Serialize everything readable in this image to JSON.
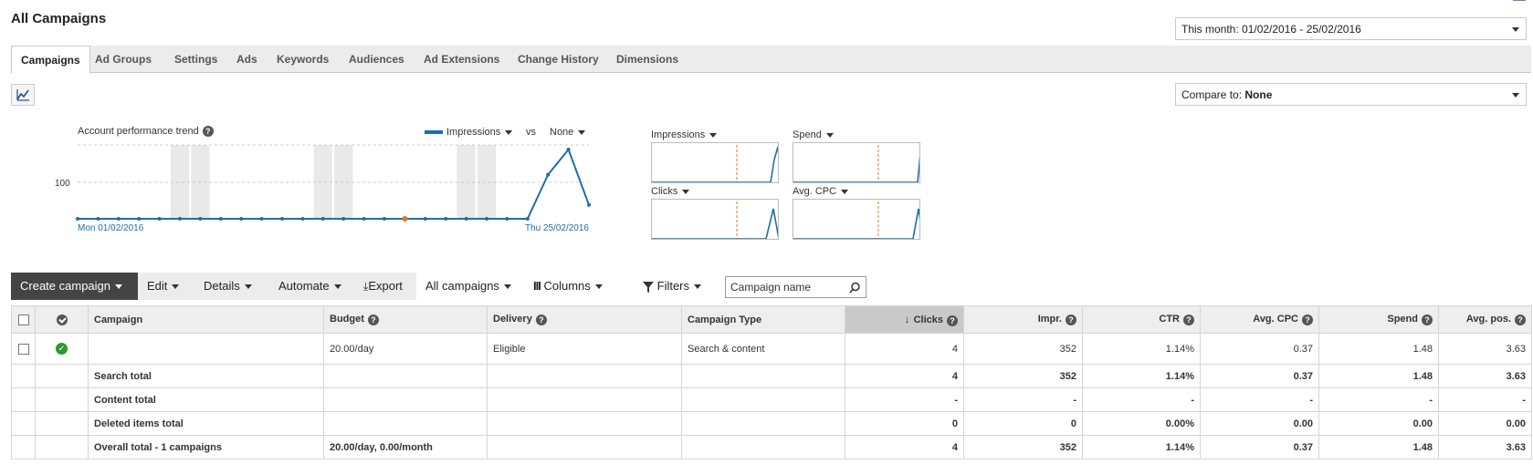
{
  "page": {
    "title": "All Campaigns"
  },
  "date_range": {
    "label": "This month: 01/02/2016 - 25/02/2016"
  },
  "compare": {
    "prefix": "Compare to: ",
    "value": "None"
  },
  "tabs": [
    {
      "label": "Campaigns",
      "active": true
    },
    {
      "label": "Ad Groups"
    },
    {
      "label": "Settings"
    },
    {
      "label": "Ads"
    },
    {
      "label": "Keywords"
    },
    {
      "label": "Audiences"
    },
    {
      "label": "Ad Extensions"
    },
    {
      "label": "Change History"
    },
    {
      "label": "Dimensions"
    }
  ],
  "trend": {
    "title": "Account performance trend",
    "metric": "Impressions",
    "vs": "vs",
    "compare_metric": "None",
    "y_tick": "100",
    "start_label": "Mon 01/02/2016",
    "end_label": "Thu 25/02/2016",
    "color": "#1f6ea8",
    "highlight_color": "#e8741a"
  },
  "chart_data": {
    "type": "line",
    "title": "Account performance trend",
    "series": [
      {
        "name": "Impressions",
        "values": [
          0,
          0,
          0,
          0,
          0,
          0,
          0,
          0,
          0,
          0,
          0,
          0,
          0,
          0,
          0,
          0,
          0,
          0,
          0,
          0,
          0,
          0,
          0,
          121,
          190,
          38
        ]
      }
    ],
    "x_start": "Mon 01/02/2016",
    "x_end": "Thu 25/02/2016",
    "weekend_days": [
      [
        5,
        6
      ],
      [
        12,
        13
      ],
      [
        19,
        20
      ]
    ],
    "highlight_day": 16,
    "yticks": [
      100
    ],
    "grid": true
  },
  "mini_charts": [
    {
      "label": "Impressions"
    },
    {
      "label": "Spend"
    },
    {
      "label": "Clicks"
    },
    {
      "label": "Avg. CPC"
    }
  ],
  "toolbar": {
    "create": "Create campaign",
    "edit": "Edit",
    "details": "Details",
    "automate": "Automate",
    "export": "Export",
    "all_campaigns": "All campaigns",
    "columns": "Columns",
    "filters": "Filters",
    "search_placeholder": "Campaign name"
  },
  "table": {
    "headers": {
      "campaign": "Campaign",
      "budget": "Budget",
      "delivery": "Delivery",
      "campaign_type": "Campaign Type",
      "clicks": "Clicks",
      "impr": "Impr.",
      "ctr": "CTR",
      "avg_cpc": "Avg. CPC",
      "spend": "Spend",
      "avg_pos": "Avg. pos."
    },
    "row": {
      "campaign": "",
      "budget": "20.00/day",
      "delivery": "Eligible",
      "campaign_type": "Search & content",
      "clicks": "4",
      "impr": "352",
      "ctr": "1.14%",
      "avg_cpc": "0.37",
      "spend": "1.48",
      "avg_pos": "3.63"
    },
    "totals": [
      {
        "label": "Search total",
        "budget": "",
        "clicks": "4",
        "impr": "352",
        "ctr": "1.14%",
        "avg_cpc": "0.37",
        "spend": "1.48",
        "avg_pos": "3.63"
      },
      {
        "label": "Content total",
        "budget": "",
        "clicks": "-",
        "impr": "-",
        "ctr": "-",
        "avg_cpc": "-",
        "spend": "-",
        "avg_pos": "-"
      },
      {
        "label": "Deleted items total",
        "budget": "",
        "clicks": "0",
        "impr": "0",
        "ctr": "0.00%",
        "avg_cpc": "0.00",
        "spend": "0.00",
        "avg_pos": "0.00"
      },
      {
        "label": "Overall total - 1 campaigns",
        "budget": "20.00/day, 0.00/month",
        "clicks": "4",
        "impr": "352",
        "ctr": "1.14%",
        "avg_cpc": "0.37",
        "spend": "1.48",
        "avg_pos": "3.63"
      }
    ]
  }
}
